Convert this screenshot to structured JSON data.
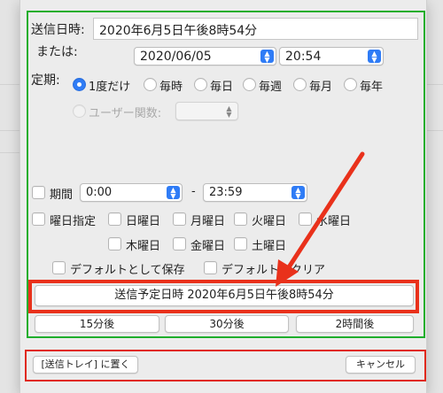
{
  "schedule": {
    "send_datetime_label": "送信日時:",
    "send_datetime_value": "2020年6月5日午後8時54分",
    "or_label": "または:",
    "date_value": "2020/06/05",
    "time_value": "20:54",
    "recurrence_label": "定期:",
    "recurrence_options": [
      "1度だけ",
      "毎時",
      "毎日",
      "毎週",
      "毎月",
      "毎年"
    ],
    "recurrence_selected": "1度だけ",
    "user_function_label": "ユーザー関数:"
  },
  "period": {
    "label": "期間",
    "start": "0:00",
    "separator": "-",
    "end": "23:59"
  },
  "weekday": {
    "specify_label": "曜日指定",
    "days": [
      "日曜日",
      "月曜日",
      "火曜日",
      "水曜日",
      "木曜日",
      "金曜日",
      "土曜日"
    ]
  },
  "defaults": {
    "save_label": "デフォルトとして保存",
    "clear_label": "デフォルトをクリア"
  },
  "scheduled_button_label": "送信予定日時 2020年6月5日午後8時54分",
  "quick_buttons": [
    "15分後",
    "30分後",
    "2時間後"
  ],
  "footer": {
    "outbox_button": "[送信トレイ] に置く",
    "cancel_button": "キャンセル"
  },
  "colors": {
    "accent_blue": "#2f7cf6",
    "highlight_green": "#1fae2c",
    "highlight_red": "#e9311b"
  }
}
